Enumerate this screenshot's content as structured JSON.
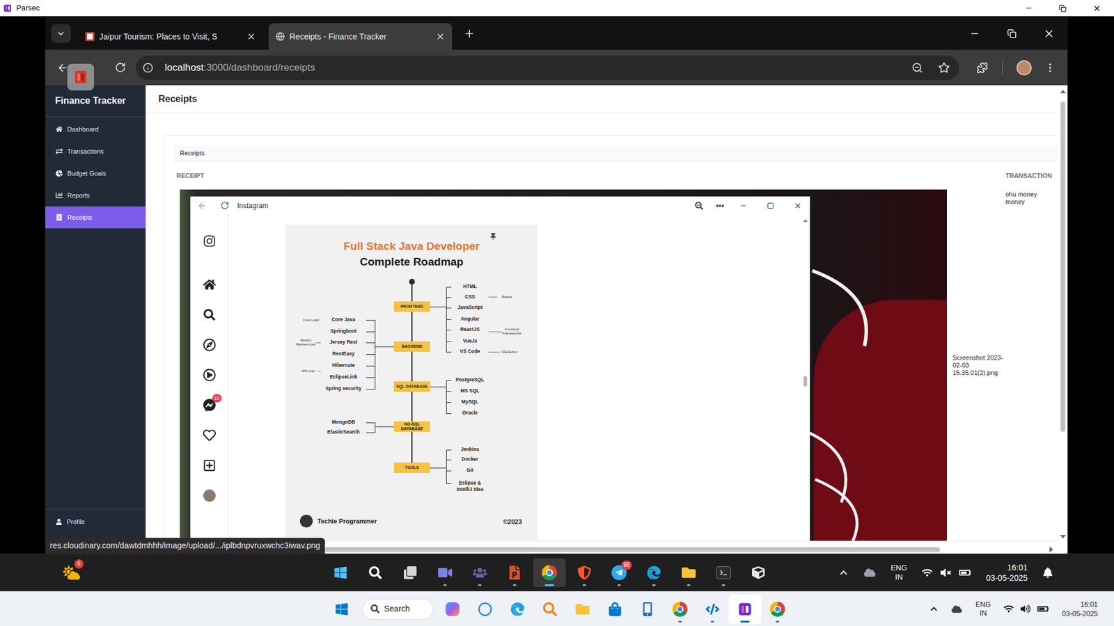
{
  "parsec": {
    "title": "Parsec"
  },
  "browser": {
    "tabs": [
      {
        "label": "Jaipur Tourism: Places to Visit, S",
        "selected": false
      },
      {
        "label": "Receipts - Finance Tracker",
        "selected": true
      }
    ],
    "url": {
      "host": "localhost",
      "path": ":3000/dashboard/receipts"
    },
    "status_link": "res.cloudinary.com/dawtdmhhh/image/upload/.../iplbdnpvruxwchc3iwav.png"
  },
  "app": {
    "brand": "Finance Tracker",
    "nav": [
      {
        "label": "Dashboard",
        "kind": "home",
        "selected": false
      },
      {
        "label": "Transactions",
        "kind": "exchange",
        "selected": false
      },
      {
        "label": "Budget Goals",
        "kind": "pie",
        "selected": false
      },
      {
        "label": "Reports",
        "kind": "chart",
        "selected": false
      },
      {
        "label": "Receipts",
        "kind": "receipt",
        "selected": true
      }
    ],
    "profile": "Profile",
    "page_title": "Receipts",
    "card_title": "Receipts",
    "table": {
      "columns": [
        "RECEIPT",
        "TRANSACTION"
      ],
      "rows": [
        {
          "file": "Screenshot 2023-02-03 15.35.01(2).png",
          "transaction": "ohu money money"
        }
      ]
    }
  },
  "receipt_screenshot": {
    "window_title": "Instagram",
    "nav": [
      {
        "kind": "logo"
      },
      {
        "kind": "home"
      },
      {
        "kind": "search"
      },
      {
        "kind": "explore"
      },
      {
        "kind": "reels"
      },
      {
        "kind": "messages",
        "badge": "10"
      },
      {
        "kind": "notifications"
      },
      {
        "kind": "create"
      },
      {
        "kind": "profile"
      }
    ],
    "post": {
      "title": "Full Stack Java Developer",
      "subtitle": "Complete Roadmap",
      "sections": [
        {
          "label": "FRONTEND",
          "side": "right",
          "items": [
            "HTML",
            "CSS",
            "JavaScript",
            "Angular",
            "ReactJS",
            "VueJs",
            "VS Code"
          ]
        },
        {
          "label": "BACKEND",
          "side": "left",
          "items": [
            "Core Java",
            "Springboot",
            "Jersey Rest",
            "RestEasy",
            "Hibernate",
            "EclipseLink",
            "Spring security"
          ]
        },
        {
          "label": "SQL DATABASE",
          "side": "right",
          "items": [
            "PostgreSQL",
            "MS SQL",
            "MySQL",
            "Oracle"
          ]
        },
        {
          "label": "NO-SQL DATABASE",
          "side": "left",
          "items": [
            "MongoDB",
            "ElasticSearch"
          ]
        },
        {
          "label": "TOOLS",
          "side": "right",
          "items": [
            "Jenkins",
            "Docker",
            "Git",
            "Eclipse & IntelliJ Idea"
          ]
        }
      ],
      "notes": [
        "Basics",
        "Frontend Frameworks",
        "IDE/Editor",
        "Core Logic",
        "Restful Webservices",
        "JPA impl"
      ],
      "author": "Techie Programmer",
      "copyright": "©2023"
    }
  },
  "remote_taskbar": {
    "weather_badge": "6",
    "apps": [
      {
        "kind": "start",
        "running": false,
        "selected": false
      },
      {
        "kind": "search",
        "running": false,
        "selected": false
      },
      {
        "kind": "taskview",
        "running": false,
        "selected": false
      },
      {
        "kind": "meet",
        "running": true,
        "selected": false
      },
      {
        "kind": "teams",
        "running": true,
        "selected": false
      },
      {
        "kind": "powerpoint",
        "running": true,
        "selected": false
      },
      {
        "kind": "chrome",
        "running": true,
        "selected": true
      },
      {
        "kind": "brave",
        "running": true,
        "selected": false
      },
      {
        "kind": "telegram",
        "running": true,
        "selected": false,
        "badge": "98"
      },
      {
        "kind": "edge",
        "running": true,
        "selected": false
      },
      {
        "kind": "files",
        "running": true,
        "selected": false
      },
      {
        "kind": "terminal",
        "running": true,
        "selected": false
      },
      {
        "kind": "cube",
        "running": false,
        "selected": false
      }
    ],
    "language": {
      "line1": "ENG",
      "line2": "IN"
    },
    "time": "16:01",
    "date": "03-05-2025"
  },
  "local_taskbar": {
    "search_label": "Search",
    "apps": [
      {
        "kind": "copilot",
        "running": false,
        "selected": false
      },
      {
        "kind": "cortana",
        "running": false,
        "selected": false
      },
      {
        "kind": "edge",
        "running": false,
        "selected": false
      },
      {
        "kind": "finder",
        "running": false,
        "selected": false
      },
      {
        "kind": "files",
        "running": false,
        "selected": false
      },
      {
        "kind": "store",
        "running": false,
        "selected": false
      },
      {
        "kind": "phone",
        "running": false,
        "selected": false
      },
      {
        "kind": "chrome",
        "running": true,
        "selected": false
      },
      {
        "kind": "vscode",
        "running": true,
        "selected": false
      },
      {
        "kind": "parsec",
        "running": true,
        "selected": true
      },
      {
        "kind": "chrome",
        "running": true,
        "selected": false
      }
    ],
    "language": {
      "line1": "ENG",
      "line2": "IN"
    },
    "time": "16:01",
    "date": "03-05-2025"
  }
}
